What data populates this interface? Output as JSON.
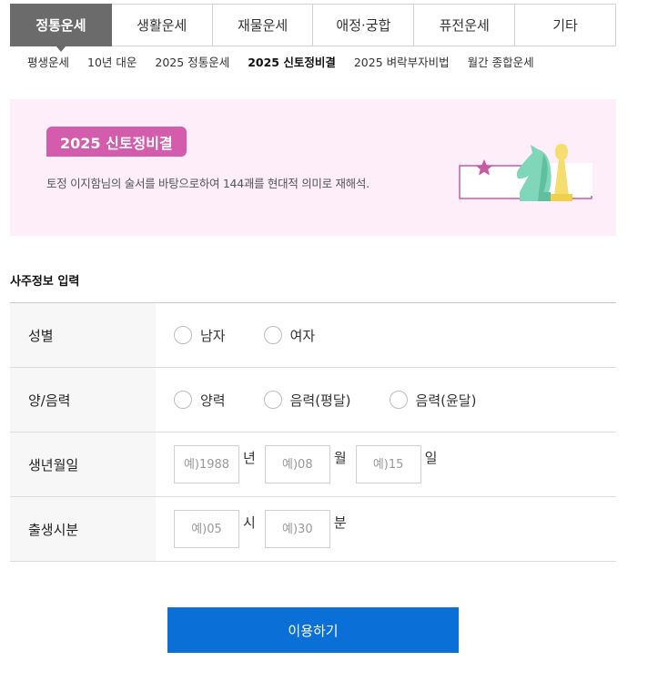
{
  "main_tabs": [
    {
      "label": "정통운세",
      "active": true
    },
    {
      "label": "생활운세",
      "active": false
    },
    {
      "label": "재물운세",
      "active": false
    },
    {
      "label": "애정·궁합",
      "active": false
    },
    {
      "label": "퓨전운세",
      "active": false
    },
    {
      "label": "기타",
      "active": false
    }
  ],
  "sub_tabs": [
    {
      "label": "평생운세",
      "active": false
    },
    {
      "label": "10년 대운",
      "active": false
    },
    {
      "label": "2025 정통운세",
      "active": false
    },
    {
      "label": "2025 신토정비결",
      "active": true
    },
    {
      "label": "2025 벼락부자비법",
      "active": false
    },
    {
      "label": "월간 종합운세",
      "active": false
    }
  ],
  "banner": {
    "title": "2025 신토정비결",
    "description": "토정 이지함님의 술서를 바탕으로하여 144괘를 현대적 의미로 재해석.",
    "colors": {
      "background": "#fdeefa",
      "badge": "#d45cac"
    }
  },
  "form": {
    "section_title": "사주정보 입력",
    "gender": {
      "label": "성별",
      "options": [
        "남자",
        "여자"
      ]
    },
    "calendar": {
      "label": "양/음력",
      "options": [
        "양력",
        "음력(평달)",
        "음력(윤달)"
      ]
    },
    "birthdate": {
      "label": "생년월일",
      "year_placeholder": "예)1988",
      "year_unit": "년",
      "month_placeholder": "예)08",
      "month_unit": "월",
      "day_placeholder": "예)15",
      "day_unit": "일"
    },
    "birthtime": {
      "label": "출생시분",
      "hour_placeholder": "예)05",
      "hour_unit": "시",
      "minute_placeholder": "예)30",
      "minute_unit": "분"
    }
  },
  "submit_label": "이용하기",
  "colors": {
    "accent": "#0a6fd6",
    "active_tab": "#6b6b6b"
  }
}
